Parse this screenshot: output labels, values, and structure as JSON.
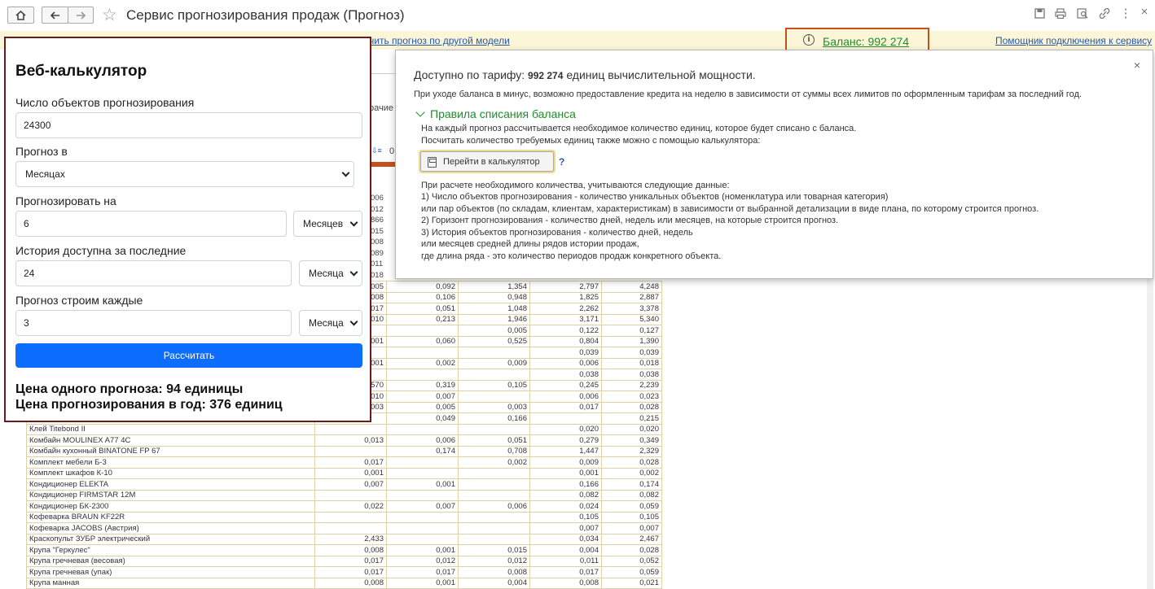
{
  "window": {
    "title": "Сервис прогнозирования продаж (Прогноз)",
    "toolbar_icons": [
      "home-icon",
      "back-icon",
      "forward-icon",
      "star-icon",
      "save-icon",
      "print-icon",
      "preview-icon",
      "link-icon",
      "more-icon",
      "close-icon"
    ]
  },
  "strip": {
    "model_link": "чить прогноз по другой модели",
    "balance_label": "Баланс: 992 274",
    "assistant_link": "Помощник подключения к сервису"
  },
  "calculator": {
    "title": "Веб-калькулятор",
    "objects_label": "Число объектов прогнозирования",
    "objects_value": "24300",
    "forecast_in_label": "Прогноз в",
    "forecast_in_value": "Месяцах",
    "horizon_label": "Прогнозировать на",
    "horizon_value": "6",
    "horizon_unit": "Месяцев",
    "history_label": "История доступна за последние",
    "history_value": "24",
    "history_unit": "Месяца",
    "every_label": "Прогноз строим каждые",
    "every_value": "3",
    "every_unit": "Месяца",
    "button": "Рассчитать",
    "result_one": "Цена одного прогноза: 94 единицы",
    "result_year": "Цена прогнозирования в год: 376 единиц"
  },
  "popup": {
    "available_prefix": "Доступно по тарифу:",
    "available_value": "992 274",
    "available_suffix": "единиц вычислительной мощности.",
    "credit_note": "При уходе баланса в минус, возможно предоставление кредита на неделю в зависимости от суммы всех лимитов по оформленным тарифам за последний год.",
    "rules_title": "Правила списания баланса",
    "rules_line1": "На каждый прогноз рассчитывается необходимое количество единиц, которое будет списано с баланса.",
    "rules_line2": "Посчитать количество требуемых единиц также можно с помощью калькулятора:",
    "goto_button": "Перейти в калькулятор",
    "help": "?",
    "details": [
      "При расчете необходимого количества, учитываются следующие данные:",
      "1) Число объектов прогнозирования - количество уникальных объектов (номенклатура или товарная категория)",
      "или пар объектов (по складам, клиентам, характеристикам) в зависимости от выбранной детализации в виде плана, по которому строится прогноз.",
      "2) Горизонт прогнозирования - количество дней, недель или месяцев, на которые строится прогноз.",
      "3) История объектов прогнозирования - количество дней, недель",
      "или месяцев средней длины рядов истории продаж,",
      "где длина ряда - это количество периодов продаж конкретного объекта."
    ]
  },
  "background": {
    "fragments": [
      "рачие",
      "0"
    ],
    "left_values": [
      "006",
      "012",
      "866",
      "015",
      "008",
      "089",
      "011",
      "018"
    ]
  },
  "table": {
    "rows": [
      [
        "",
        "005",
        "0,092",
        "1,354",
        "2,797",
        "4,248"
      ],
      [
        "",
        "008",
        "0,106",
        "0,948",
        "1,825",
        "2,887"
      ],
      [
        "",
        "017",
        "0,051",
        "1,048",
        "2,262",
        "3,378"
      ],
      [
        "",
        "010",
        "0,213",
        "1,946",
        "3,171",
        "5,340"
      ],
      [
        "",
        "",
        "",
        "0,005",
        "0,122",
        "0,127"
      ],
      [
        "",
        "001",
        "0,060",
        "0,525",
        "0,804",
        "1,390"
      ],
      [
        "",
        "",
        "",
        "",
        "0,039",
        "0,039"
      ],
      [
        "",
        "001",
        "0,002",
        "0,009",
        "0,006",
        "0,018"
      ],
      [
        "",
        "",
        "",
        "",
        "0,038",
        "0,038"
      ],
      [
        "",
        "570",
        "0,319",
        "0,105",
        "0,245",
        "2,239"
      ],
      [
        "",
        "010",
        "0,007",
        "",
        "0,006",
        "0,023"
      ],
      [
        "",
        "003",
        "0,005",
        "0,003",
        "0,017",
        "0,028"
      ],
      [
        "",
        "",
        "0,049",
        "0,166",
        "",
        "0,215"
      ],
      [
        "Клей Titebond II",
        "",
        "",
        "",
        "0,020",
        "0,020"
      ],
      [
        "Комбайн MOULINEX  A77 4C",
        "0,013",
        "0,006",
        "0,051",
        "0,279",
        "0,349"
      ],
      [
        "Комбайн кухонный BINATONE FP 67",
        "",
        "0,174",
        "0,708",
        "1,447",
        "2,329"
      ],
      [
        "Комплект мебели Б-3",
        "0,017",
        "",
        "0,002",
        "0,009",
        "0,028"
      ],
      [
        "Комплект шкафов К-10",
        "0,001",
        "",
        "",
        "0,001",
        "0,002"
      ],
      [
        "Кондиционер ELEKTA",
        "0,007",
        "0,001",
        "",
        "0,166",
        "0,174"
      ],
      [
        "Кондиционер FIRMSTAR 12M",
        "",
        "",
        "",
        "0,082",
        "0,082"
      ],
      [
        "Кондиционер БК-2300",
        "0,022",
        "0,007",
        "0,006",
        "0,024",
        "0,059"
      ],
      [
        "Кофеварка BRAUN KF22R",
        "",
        "",
        "",
        "0,105",
        "0,105"
      ],
      [
        "Кофеварка JACOBS (Австрия)",
        "",
        "",
        "",
        "0,007",
        "0,007"
      ],
      [
        "Краскопульт ЗУБР электрический",
        "2,433",
        "",
        "",
        "0,034",
        "2,467"
      ],
      [
        "Крупа \"Геркулес\"",
        "0,008",
        "0,001",
        "0,015",
        "0,004",
        "0,028"
      ],
      [
        "Крупа гречневая (весовая)",
        "0,017",
        "0,012",
        "0,012",
        "0,011",
        "0,052"
      ],
      [
        "Крупа гречневая (упак)",
        "0,017",
        "0,017",
        "0,008",
        "0,017",
        "0,059"
      ],
      [
        "Крупа манная",
        "0,008",
        "0,001",
        "0,004",
        "0,008",
        "0,021"
      ]
    ]
  },
  "colors": {
    "accent_red": "#c4501e",
    "balance_green": "#1f8c2a",
    "link_blue": "#2a56a6",
    "calc_button": "#0d6efd",
    "strip_yellow": "#fbf6d8"
  }
}
